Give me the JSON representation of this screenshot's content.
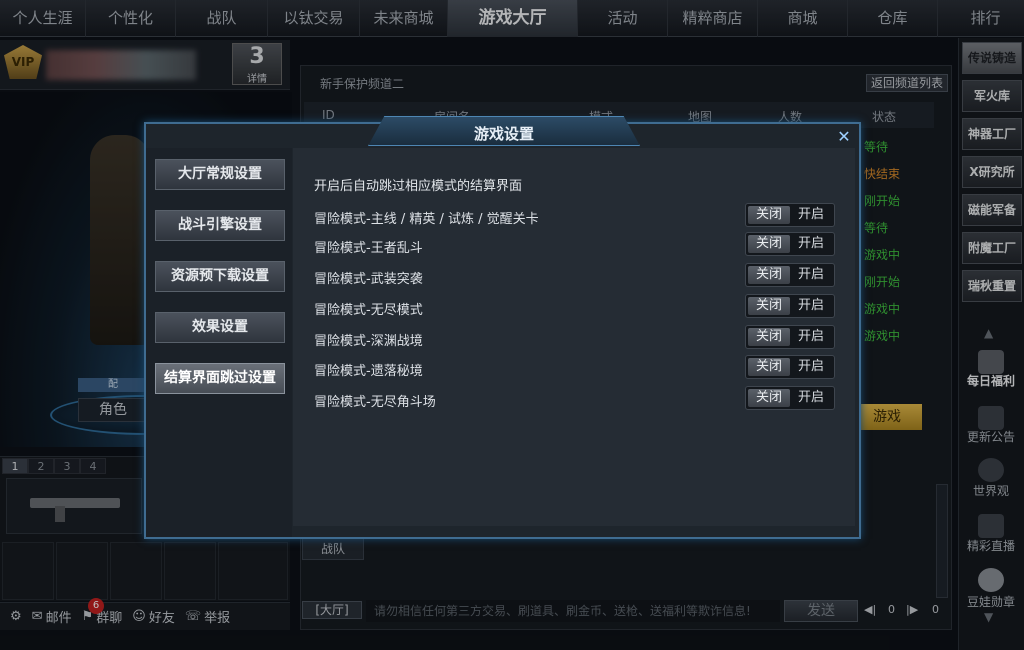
{
  "top_nav": {
    "tabs": [
      "个人生涯",
      "个性化",
      "战队",
      "以钛交易",
      "未来商城",
      "游戏大厅",
      "活动",
      "精粹商店",
      "商城",
      "仓库",
      "排行"
    ],
    "active": "游戏大厅"
  },
  "profile": {
    "vip_label": "VIP",
    "rank_number": "3",
    "rank_label": "详情",
    "role_tag": "配",
    "role_button": "角色"
  },
  "weapon_tabs": [
    "1",
    "2",
    "3",
    "4"
  ],
  "bottom_bar": {
    "mail": "邮件",
    "mail_badge": "6",
    "group_chat": "群聊",
    "friends": "好友",
    "report": "举报"
  },
  "lobby": {
    "channel_title": "新手保护频道二",
    "back_button": "返回频道列表",
    "columns": [
      "ID",
      "房间名",
      "模式",
      "地图",
      "人数",
      "状态"
    ],
    "statuses": [
      {
        "text": "等待",
        "color": "#3fbf3f"
      },
      {
        "text": "快结束",
        "color": "#d98a2a"
      },
      {
        "text": "刚开始",
        "color": "#3fbf3f"
      },
      {
        "text": "等待",
        "color": "#3fbf3f"
      },
      {
        "text": "游戏中",
        "color": "#3fbf3f"
      },
      {
        "text": "刚开始",
        "color": "#3fbf3f"
      },
      {
        "text": "游戏中",
        "color": "#3fbf3f"
      },
      {
        "text": "游戏中",
        "color": "#3fbf3f"
      }
    ],
    "quick_button": "游戏",
    "team_tab": "战队"
  },
  "chat": {
    "channel": "[大厅]",
    "placeholder": "请勿相信任何第三方交易、刷道具、刷金币、送枪、送福利等欺诈信息!",
    "send": "发送",
    "vol_left": "0",
    "vol_right": "0"
  },
  "right_sidebar": {
    "items": [
      "传说铸造",
      "军火库",
      "神器工厂",
      "X研究所",
      "磁能军备",
      "附魔工厂",
      "瑞秋重置"
    ],
    "links": [
      "每日福利",
      "更新公告",
      "世界观",
      "精彩直播",
      "豆娃勋章"
    ]
  },
  "modal": {
    "title": "游戏设置",
    "nav": [
      "大厅常规设置",
      "战斗引擎设置",
      "资源预下载设置",
      "效果设置",
      "结算界面跳过设置"
    ],
    "active_nav": "结算界面跳过设置",
    "intro": "开启后自动跳过相应模式的结算界面",
    "rows": [
      {
        "label": "冒险模式-主线 / 精英 / 试炼 / 觉醒关卡",
        "off": "关闭",
        "on": "开启",
        "state": "off"
      },
      {
        "label": "冒险模式-王者乱斗",
        "off": "关闭",
        "on": "开启",
        "state": "off"
      },
      {
        "label": "冒险模式-武装突袭",
        "off": "关闭",
        "on": "开启",
        "state": "off"
      },
      {
        "label": "冒险模式-无尽模式",
        "off": "关闭",
        "on": "开启",
        "state": "off"
      },
      {
        "label": "冒险模式-深渊战境",
        "off": "关闭",
        "on": "开启",
        "state": "off"
      },
      {
        "label": "冒险模式-遗落秘境",
        "off": "关闭",
        "on": "开启",
        "state": "off"
      },
      {
        "label": "冒险模式-无尽角斗场",
        "off": "关闭",
        "on": "开启",
        "state": "off"
      }
    ]
  }
}
